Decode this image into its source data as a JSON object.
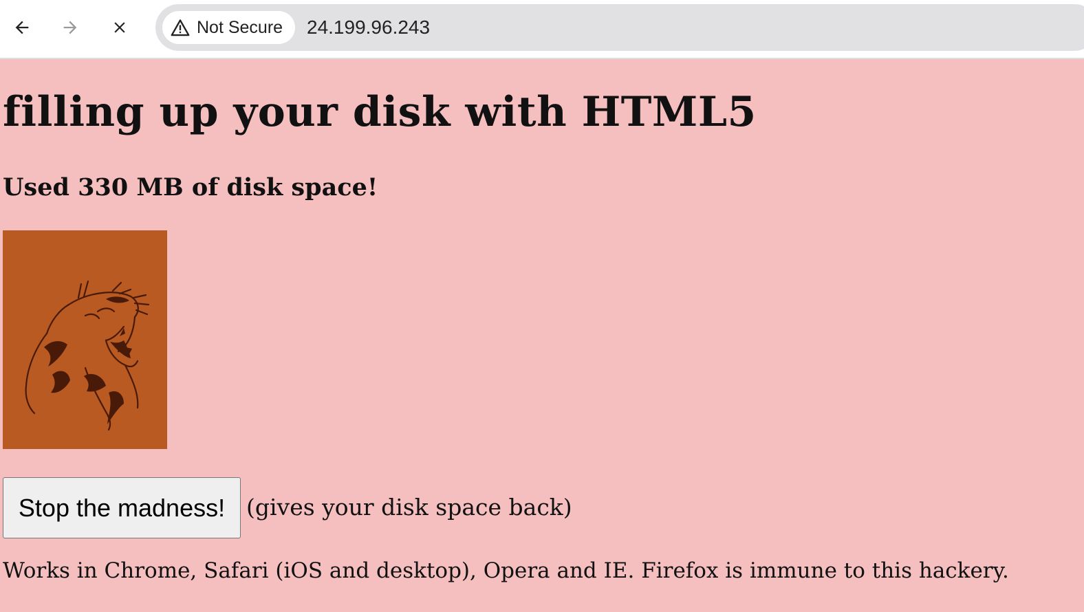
{
  "browser": {
    "security_label": "Not Secure",
    "url": "24.199.96.243",
    "icons": [
      "back-arrow-icon",
      "forward-arrow-icon",
      "stop-loading-icon",
      "warning-triangle-icon"
    ]
  },
  "page": {
    "title": "filling up your disk with HTML5",
    "usage_text": "Used 330 MB of disk space!",
    "image": "roaring-mountain-lion-illustration",
    "stop_button_label": "Stop the madness!",
    "stop_hint": "(gives your disk space back)",
    "compat_note": "Works in Chrome, Safari (iOS and desktop), Opera and IE. Firefox is immune to this hackery."
  },
  "colors": {
    "page_background": "#f5bfbf",
    "image_background": "#b85a22",
    "image_ink": "#4a1a08",
    "omnibox": "#e1e1e4"
  }
}
